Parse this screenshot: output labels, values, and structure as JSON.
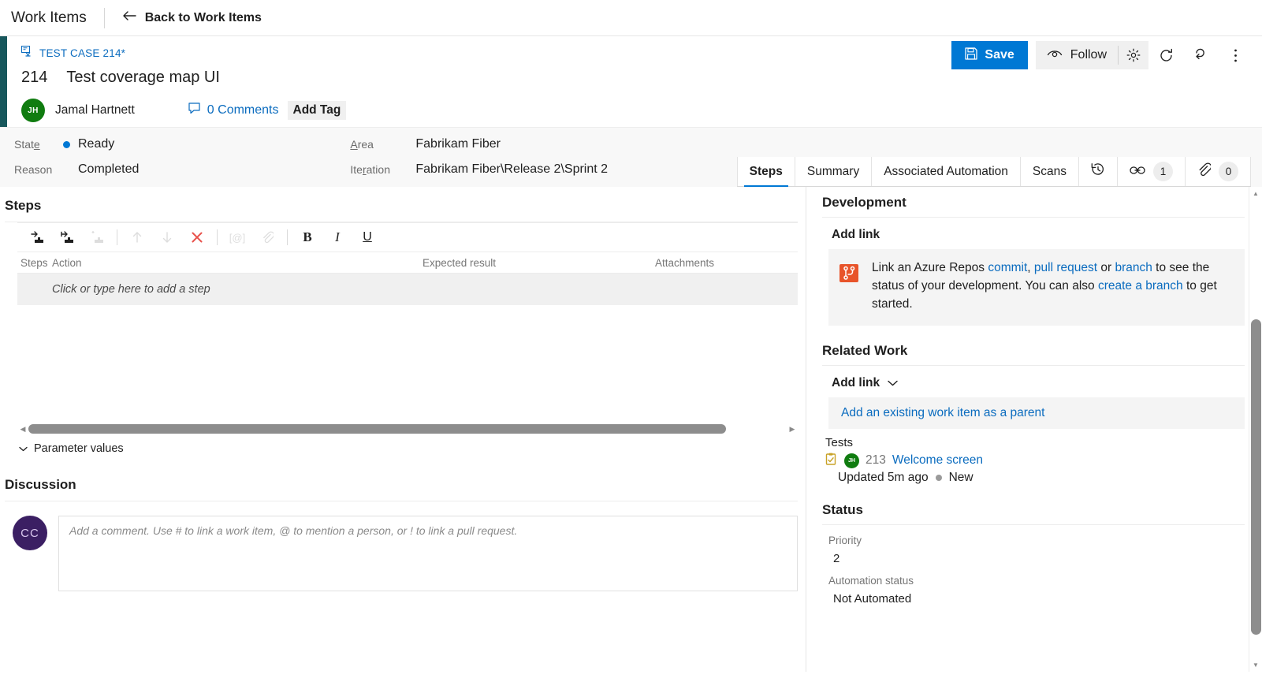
{
  "topbar": {
    "title": "Work Items",
    "back_label": "Back to Work Items",
    "back_icon": "back-arrow-icon"
  },
  "workitem": {
    "breadcrumb": "TEST CASE 214*",
    "type_icon": "test-case-icon",
    "id": "214",
    "title": "Test coverage map UI",
    "assignee": {
      "name": "Jamal Hartnett",
      "initials": "JH",
      "avatar_color": "#107c10"
    },
    "comments_label": "0 Comments",
    "comments_icon": "comment-bubble-icon",
    "add_tag_label": "Add Tag",
    "accent_color": "#17575c"
  },
  "actions": {
    "save_label": "Save",
    "save_icon": "save-disk-icon",
    "save_color": "#0078d4",
    "follow_label": "Follow",
    "follow_icon": "eye-icon",
    "gear_icon": "gear-icon",
    "refresh_icon": "refresh-icon",
    "revert_icon": "undo-icon",
    "more_icon": "more-vertical-icon"
  },
  "fields": {
    "state": {
      "label": "State",
      "value": "Ready",
      "dot_color": "#0078d4"
    },
    "reason": {
      "label": "Reason",
      "value": "Completed"
    },
    "area": {
      "label": "Area",
      "value": "Fabrikam Fiber"
    },
    "iteration": {
      "label": "Iteration",
      "value": "Fabrikam Fiber\\Release 2\\Sprint 2"
    }
  },
  "tabs": [
    {
      "label": "Steps",
      "active": true
    },
    {
      "label": "Summary",
      "active": false
    },
    {
      "label": "Associated Automation",
      "active": false
    },
    {
      "label": "Scans",
      "active": false
    }
  ],
  "tab_icons": [
    {
      "name": "history-icon",
      "count": null
    },
    {
      "name": "link-icon",
      "count": "1"
    },
    {
      "name": "attachment-icon",
      "count": "0"
    }
  ],
  "steps": {
    "section_title": "Steps",
    "toolbar": [
      {
        "name": "insert-step-icon",
        "disabled": false
      },
      {
        "name": "insert-shared-step-icon",
        "disabled": false
      },
      {
        "name": "insert-step-above-icon",
        "disabled": true
      },
      {
        "name": "move-up-icon",
        "disabled": true
      },
      {
        "name": "move-down-icon",
        "disabled": true
      },
      {
        "name": "delete-icon",
        "disabled": false
      },
      {
        "name": "parameter-icon",
        "disabled": true
      },
      {
        "name": "attach-icon",
        "disabled": true
      },
      {
        "name": "bold-icon",
        "disabled": false
      },
      {
        "name": "italic-icon",
        "disabled": false
      },
      {
        "name": "underline-icon",
        "disabled": false
      }
    ],
    "columns": {
      "steps": "Steps",
      "action": "Action",
      "expected": "Expected result",
      "attachments": "Attachments"
    },
    "empty_row": "Click or type here to add a step",
    "parameter_values": "Parameter values"
  },
  "discussion": {
    "title": "Discussion",
    "avatar_initials": "CC",
    "avatar_color": "#3b1f63",
    "placeholder": "Add a comment. Use # to link a work item, @ to mention a person, or ! to link a pull request."
  },
  "development": {
    "title": "Development",
    "add_link_label": "Add link",
    "repo_icon": "azure-repos-icon",
    "text_1": "Link an Azure Repos ",
    "link_commit": "commit",
    "text_2": ", ",
    "link_pull_request": "pull request",
    "text_3": " or ",
    "link_branch": "branch",
    "text_4": " to see the status of your development. You can also ",
    "link_create_branch": "create a branch",
    "text_5": " to get started."
  },
  "related_work": {
    "title": "Related Work",
    "add_link_label": "Add link",
    "chevron_icon": "chevron-down-icon",
    "add_parent_label": "Add an existing work item as a parent",
    "group_label": "Tests",
    "item": {
      "icon": "test-case-small-icon",
      "avatar_initials": "JH",
      "avatar_color": "#107c10",
      "id": "213",
      "name": "Welcome screen",
      "updated": "Updated 5m ago",
      "state": "New",
      "state_dot_color": "#9a9a9a"
    }
  },
  "status": {
    "title": "Status",
    "priority_label": "Priority",
    "priority_value": "2",
    "automation_label": "Automation status",
    "automation_value": "Not Automated"
  }
}
